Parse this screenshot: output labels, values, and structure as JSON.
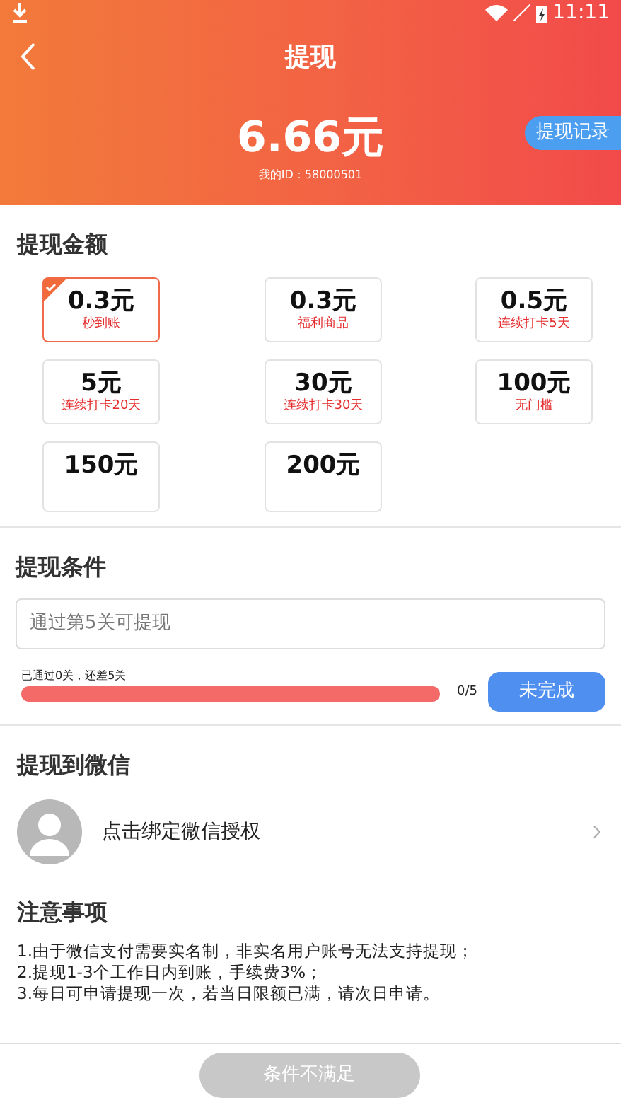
{
  "status_bar": {
    "time": "11:11"
  },
  "header": {
    "title": "提现",
    "balance": "6.66元",
    "user_id": "我的ID：58000501",
    "record_button": "提现记录"
  },
  "amount_section": {
    "title": "提现金额",
    "options": [
      {
        "amount": "0.3元",
        "note": "秒到账",
        "selected": true
      },
      {
        "amount": "0.3元",
        "note": "福利商品",
        "selected": false
      },
      {
        "amount": "0.5元",
        "note": "连续打卡5天",
        "selected": false
      },
      {
        "amount": "5元",
        "note": "连续打卡20天",
        "selected": false
      },
      {
        "amount": "30元",
        "note": "连续打卡30天",
        "selected": false
      },
      {
        "amount": "100元",
        "note": "无门槛",
        "selected": false
      },
      {
        "amount": "150元",
        "selected": false
      },
      {
        "amount": "200元",
        "selected": false
      }
    ]
  },
  "condition_section": {
    "title": "提现条件",
    "condition": "通过第5关可提现",
    "progress_label": "已通过0关，还差5关",
    "reading": "0/5",
    "status_button": "未完成"
  },
  "wechat_section": {
    "title": "提现到微信",
    "bind_text": "点击绑定微信授权"
  },
  "notes_section": {
    "title": "注意事项",
    "lines": [
      "1.由于微信支付需要实名制，非实名用户账号无法支持提现；",
      "2.提现1-3个工作日内到账，手续费3%；",
      "3.每日可申请提现一次，若当日限额已满，请次日申请。"
    ]
  },
  "submit_button": {
    "label": "条件不满足",
    "disabled": true
  }
}
